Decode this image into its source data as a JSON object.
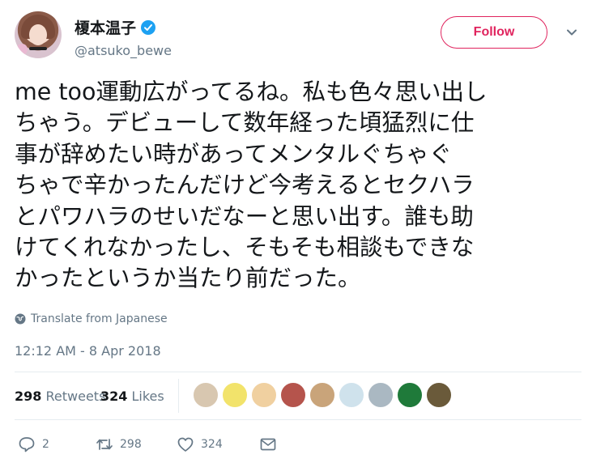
{
  "user": {
    "display_name": "榎本温子",
    "handle": "@atsuko_bewe",
    "verified": true
  },
  "follow_button": {
    "label": "Follow"
  },
  "tweet": {
    "lines": [
      "me too運動広がってるね。私も色々思い出し",
      "ちゃう。デビューして数年経った頃猛烈に仕",
      "事が辞めたい時があってメンタルぐちゃぐ",
      "ちゃで辛かったんだけど今考えるとセクハラ",
      "とパワハラのせいだなーと思い出す。誰も助",
      "けてくれなかったし、そもそも相談もできな",
      "かったというか当たり前だった。"
    ]
  },
  "translate": {
    "label": "Translate from Japanese",
    "icon": "globe-icon"
  },
  "timestamp": "12:12 AM - 8 Apr 2018",
  "stats": {
    "retweets_count": "298",
    "retweets_label": "Retweets",
    "likes_count": "324",
    "likes_label": "Likes"
  },
  "likers": [
    {
      "color": "#d8c7b0"
    },
    {
      "color": "#f2e36b"
    },
    {
      "color": "#f0d0a0"
    },
    {
      "color": "#b5544c"
    },
    {
      "color": "#c9a47a"
    },
    {
      "color": "#cfe2ec"
    },
    {
      "color": "#aab8c2"
    },
    {
      "color": "#1f7a3a"
    },
    {
      "color": "#6a5a3a"
    }
  ],
  "actions": {
    "reply_count": "2",
    "retweet_count": "298",
    "like_count": "324"
  },
  "colors": {
    "accent": "#e0245e",
    "verified": "#1da1f2",
    "muted": "#657786"
  }
}
